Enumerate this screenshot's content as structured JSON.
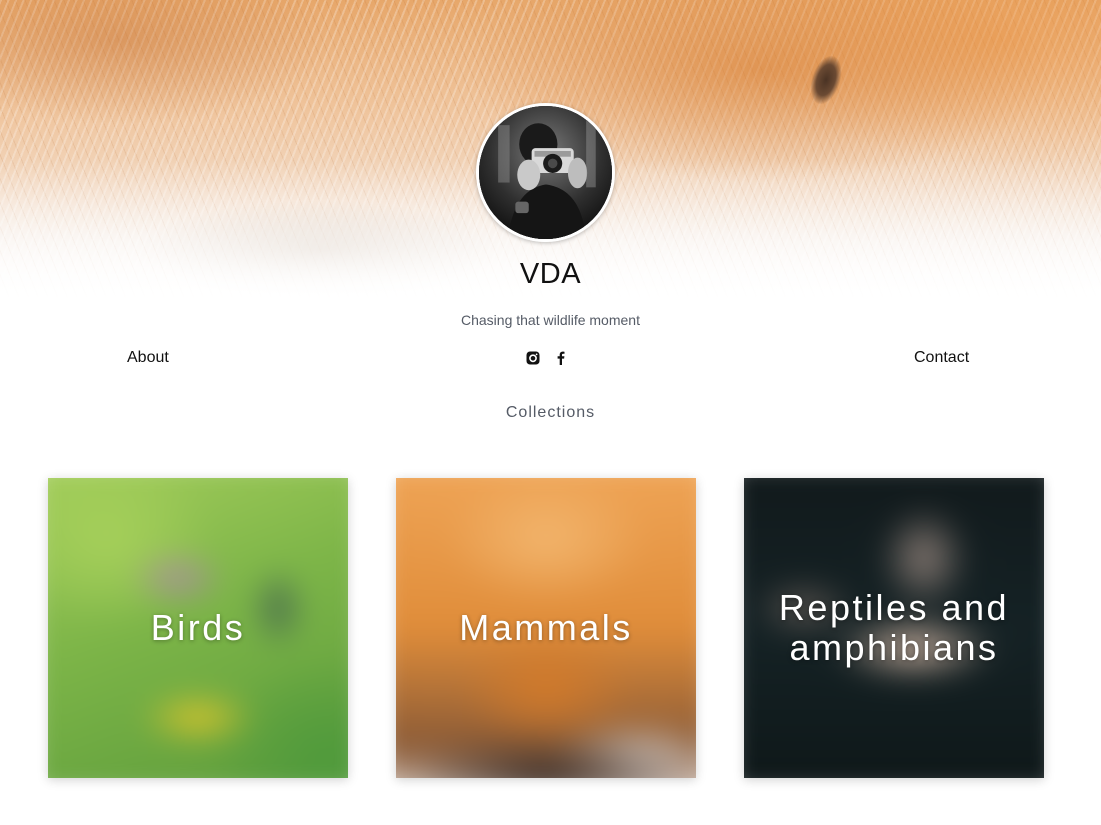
{
  "profile": {
    "name": "VDA",
    "tagline": "Chasing that wildlife moment"
  },
  "nav": {
    "about_label": "About",
    "contact_label": "Contact",
    "social": [
      {
        "icon": "instagram-icon"
      },
      {
        "icon": "facebook-icon"
      }
    ]
  },
  "collections": {
    "title": "Collections",
    "items": [
      {
        "label": "Birds"
      },
      {
        "label": "Mammals"
      },
      {
        "label": "Reptiles and amphibians"
      }
    ]
  },
  "colors": {
    "text": "#111111",
    "muted": "#555b66",
    "background": "#ffffff"
  }
}
